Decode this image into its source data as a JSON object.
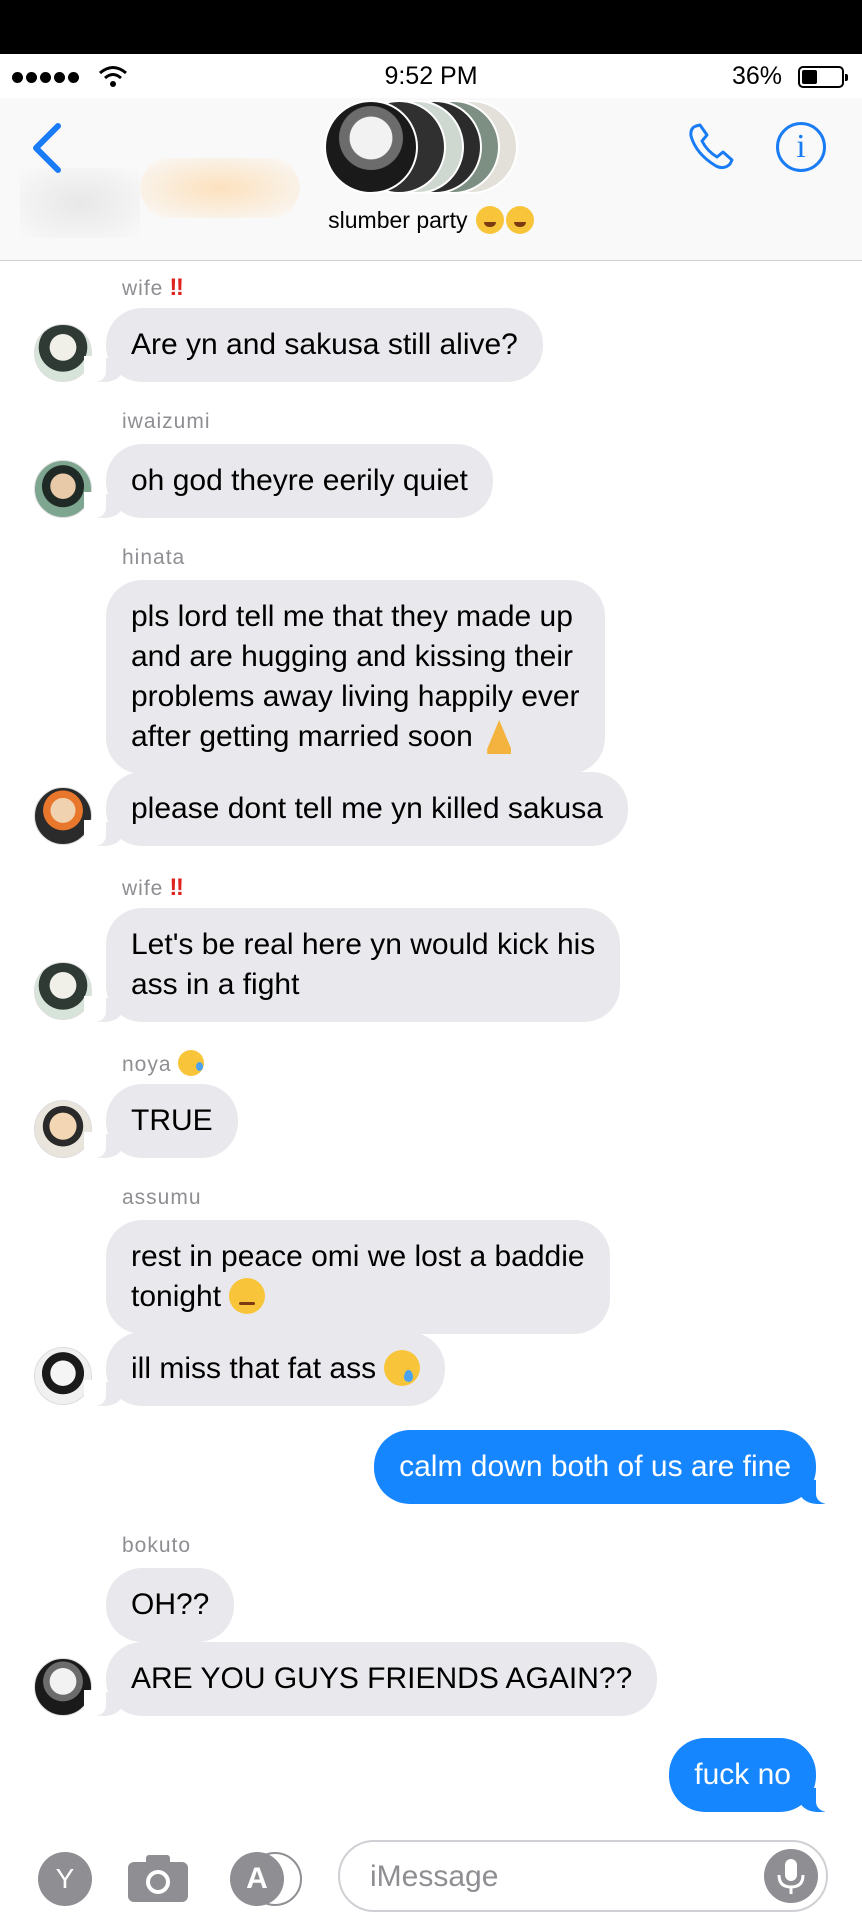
{
  "status_bar": {
    "time": "9:52 PM",
    "battery": "36%",
    "battery_level": 0.36
  },
  "header": {
    "group_name": "slumber party",
    "group_emoji": "partying-face-emoji"
  },
  "messages": [
    {
      "sender": "wife",
      "sender_emoji": "‼",
      "text": "Are yn and sakusa still alive?"
    },
    {
      "sender": "iwaizumi",
      "text": "oh god theyre eerily quiet"
    },
    {
      "sender": "hinata",
      "text": "pls lord tell me that they made up\nand are hugging and kissing their\nproblems away living happily ever\nafter getting married soon",
      "emoji": "folded-hands-emoji"
    },
    {
      "text": "please dont tell me yn killed sakusa"
    },
    {
      "sender": "wife",
      "sender_emoji": "‼",
      "text": "Let's be real here yn would kick his\nass in a fight"
    },
    {
      "sender": "noya",
      "sender_emoji_name": "sleepy-face-emoji",
      "text": "TRUE"
    },
    {
      "sender": "assumu",
      "text": "rest in peace omi we lost a baddie\ntonight",
      "emoji": "pensive-face-emoji"
    },
    {
      "text": "ill miss that fat ass",
      "emoji": "crying-face-emoji"
    },
    {
      "outgoing": true,
      "text": "calm down both of us are fine"
    },
    {
      "sender": "bokuto",
      "text": "OH??"
    },
    {
      "text": "ARE YOU GUYS FRIENDS AGAIN??"
    },
    {
      "outgoing": true,
      "text": "fuck no"
    }
  ],
  "input_bar": {
    "app_label": "Y",
    "placeholder": "iMessage",
    "appstore_label": "A"
  },
  "colors": {
    "incoming_bubble": "#e9e9ed",
    "outgoing_bubble": "#1686ff",
    "accent": "#1a7cf4",
    "alert": "#e0231f"
  }
}
